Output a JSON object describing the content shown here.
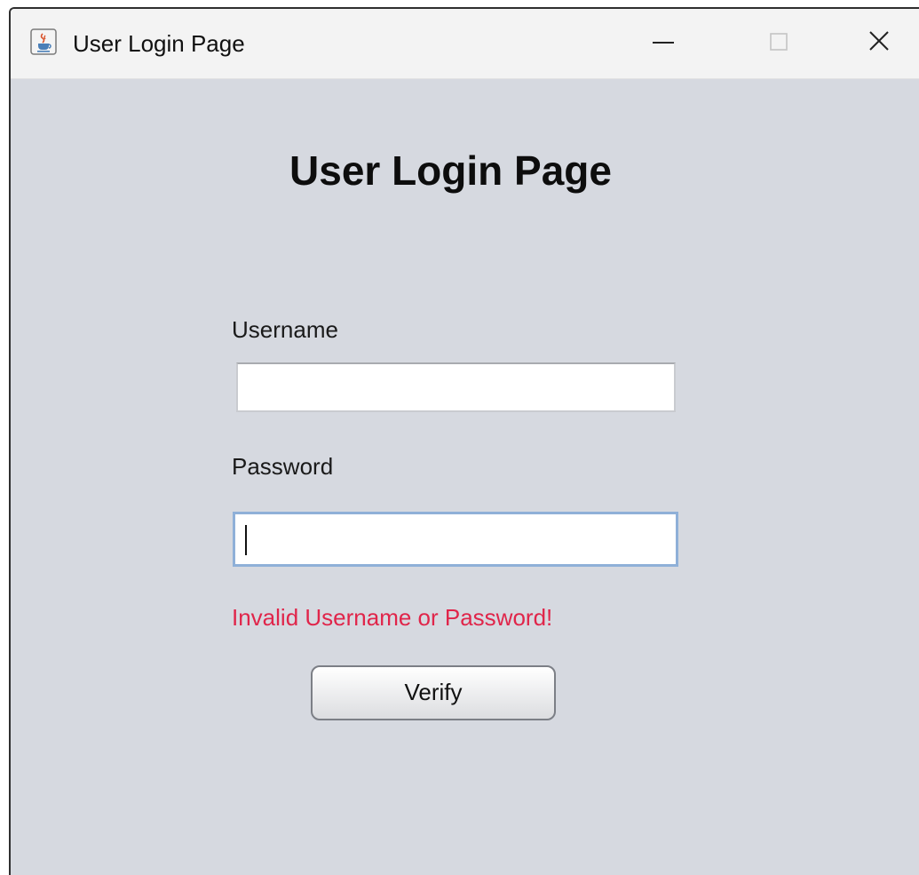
{
  "window": {
    "title": "User Login Page",
    "icon": "java-cup-icon",
    "controls": [
      "minimize-icon",
      "maximize-icon",
      "close-icon"
    ]
  },
  "form": {
    "heading": "User Login Page",
    "username_label": "Username",
    "username_value": "",
    "password_label": "Password",
    "password_value": "",
    "error_message": "Invalid Username or Password!",
    "verify_label": "Verify"
  },
  "colors": {
    "background": "#d6d9e0",
    "error": "#e0254a",
    "focus_border": "#8fb0d8"
  }
}
